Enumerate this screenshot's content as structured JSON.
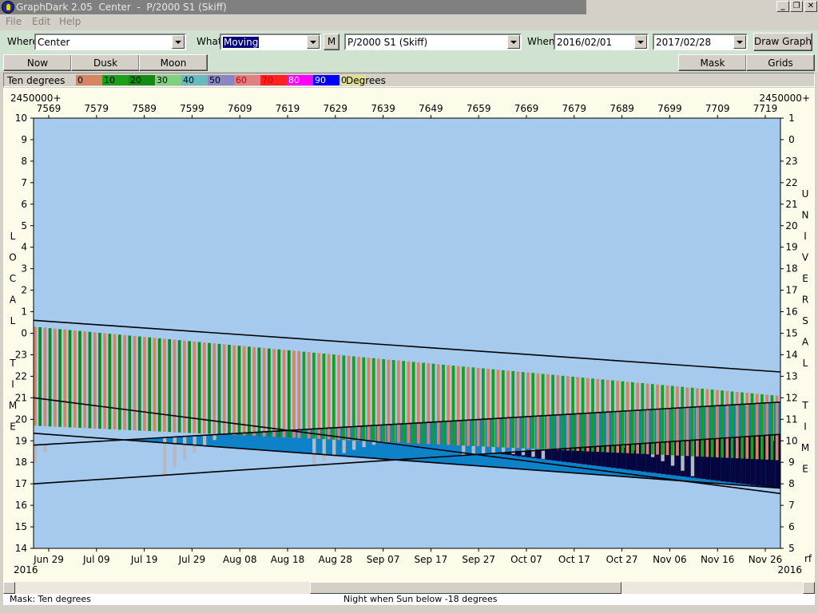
{
  "window": {
    "title": "GraphDark 2.05  Center  -  P/2000 S1 (Skiff)",
    "minimize_glyph": "_",
    "restore_glyph": "❐",
    "close_glyph": "✕"
  },
  "menu": {
    "file": "File",
    "edit": "Edit",
    "help": "Help"
  },
  "toolbar": {
    "where_label": "Where",
    "where_value": "Center",
    "what_label": "What",
    "what_value": "Moving",
    "m_button": "M",
    "object_value": "P/2000 S1 (Skiff)",
    "when_label": "When",
    "start_date": "2016/02/01",
    "end_date": "2017/02/28",
    "draw_button": "Draw Graph"
  },
  "toolbar2": {
    "now": "Now",
    "dusk": "Dusk",
    "moon": "Moon",
    "mask": "Mask",
    "grids": "Grids"
  },
  "legend": {
    "label": "Ten degrees",
    "unit": "Degrees",
    "swatches": [
      {
        "text": "0",
        "color": "#d38660",
        "text_color": "#000000"
      },
      {
        "text": "10",
        "color": "#1a9f1a",
        "text_color": "#000000"
      },
      {
        "text": "20",
        "color": "#138a13",
        "text_color": "#000000"
      },
      {
        "text": "30",
        "color": "#7ed07e",
        "text_color": "#000000"
      },
      {
        "text": "40",
        "color": "#6ab8c0",
        "text_color": "#000000"
      },
      {
        "text": "50",
        "color": "#8a86c4",
        "text_color": "#000000"
      },
      {
        "text": "60",
        "color": "#e08080",
        "text_color": "#c00000"
      },
      {
        "text": "70",
        "color": "#ff2020",
        "text_color": "#c00000"
      },
      {
        "text": "80",
        "color": "#ff00ff",
        "text_color": "#ffffff"
      },
      {
        "text": "90",
        "color": "#0000ff",
        "text_color": "#ffffff"
      },
      {
        "text": "0",
        "color": "#e0e090",
        "text_color": "#000000"
      }
    ]
  },
  "graph": {
    "jd_prefix_left": "2450000+",
    "jd_prefix_right": "2450000+",
    "jd_ticks": [
      "7569",
      "7579",
      "7589",
      "7599",
      "7609",
      "7619",
      "7629",
      "7639",
      "7649",
      "7659",
      "7669",
      "7679",
      "7689",
      "7699",
      "7709",
      "7719"
    ],
    "date_ticks": [
      "Jun 29",
      "Jul 09",
      "Jul 19",
      "Jul 29",
      "Aug 08",
      "Aug 18",
      "Aug 28",
      "Sep 07",
      "Sep 17",
      "Sep 27",
      "Oct 07",
      "Oct 17",
      "Oct 27",
      "Nov 06",
      "Nov 16",
      "Nov 26"
    ],
    "year_left": "2016",
    "year_right": "2016",
    "corner_right": "rf",
    "local_time_ticks": [
      "10",
      "9",
      "8",
      "7",
      "6",
      "5",
      "4",
      "3",
      "2",
      "1",
      "0",
      "23",
      "22",
      "21",
      "20",
      "19",
      "18",
      "17",
      "16",
      "15",
      "14"
    ],
    "ut_ticks": [
      "1",
      "0",
      "23",
      "22",
      "21",
      "20",
      "19",
      "18",
      "17",
      "16",
      "15",
      "14",
      "13",
      "12",
      "11",
      "10",
      "9",
      "8",
      "7",
      "6",
      "5"
    ],
    "local_time_label": [
      "L",
      "O",
      "C",
      "A",
      "L",
      "",
      "T",
      "I",
      "M",
      "E"
    ],
    "universal_time_label": [
      "U",
      "N",
      "I",
      "V",
      "E",
      "R",
      "S",
      "A",
      "L",
      "",
      "T",
      "I",
      "M",
      "E"
    ],
    "colors": {
      "day": "#a6c9ee",
      "night": "#050540",
      "object": "#b4b9c4",
      "twilight": "#0e82c8",
      "alt0": "#d38660",
      "alt10": "#1a9f1a",
      "alt20": "#138a13",
      "alt_low": "#0a5a1e"
    }
  },
  "status": {
    "mask": "Mask:  Ten degrees",
    "night_rule": "Night when Sun below -18 degrees"
  }
}
